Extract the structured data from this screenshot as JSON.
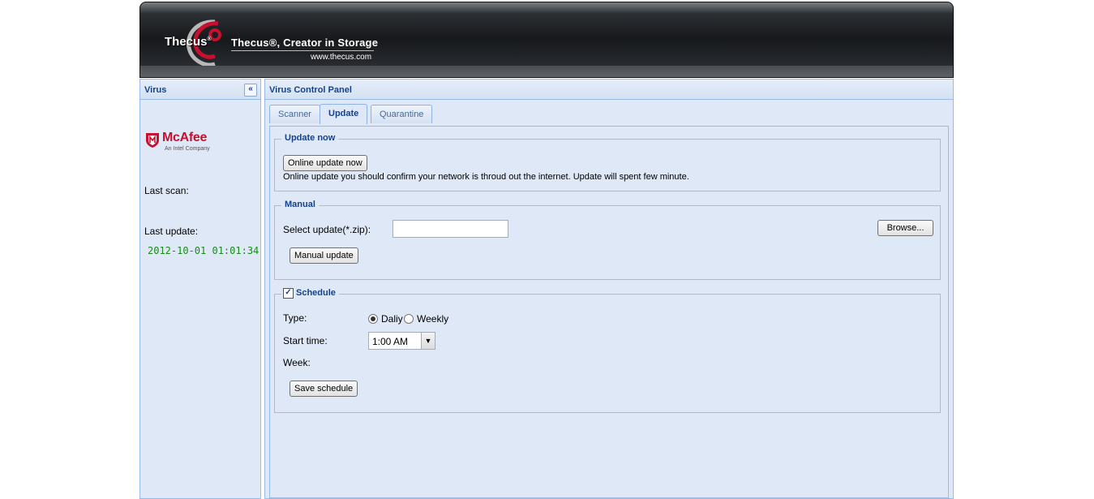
{
  "header": {
    "logo_text": "Thecus",
    "logo_mark": "®",
    "tagline": "Thecus®, Creator in Storage",
    "url": "www.thecus.com"
  },
  "left_panel": {
    "title": "Virus",
    "collapse_glyph": "«",
    "vendor_name": "McAfee",
    "vendor_sub": "An Intel Company",
    "last_scan_label": "Last scan:",
    "last_update_label": "Last update:",
    "last_update_value": "2012-10-01 01:01:34"
  },
  "main": {
    "title": "Virus Control Panel",
    "tabs": [
      {
        "label": "Scanner",
        "active": false
      },
      {
        "label": "Update",
        "active": true
      },
      {
        "label": "Quarantine",
        "active": false
      }
    ],
    "update_now": {
      "legend": "Update now",
      "button": "Online update now",
      "note": "Online update you should confirm your network is throud out the internet. Update will spent few minute."
    },
    "manual": {
      "legend": "Manual",
      "select_label": "Select update(*.zip):",
      "file_value": "",
      "browse_button": "Browse...",
      "update_button": "Manual update"
    },
    "schedule": {
      "legend": "Schedule",
      "enabled": true,
      "check_glyph": "✓",
      "type_label": "Type:",
      "type_options": [
        "Daliy",
        "Weekly"
      ],
      "type_selected": "Daliy",
      "start_time_label": "Start time:",
      "start_time_value": "1:00 AM",
      "week_label": "Week:",
      "save_button": "Save schedule"
    }
  },
  "colors": {
    "panel_bg": "#dfe8f6",
    "header_text": "#15428b",
    "date_green": "#1a8a1a",
    "mcafee_red": "#c8102e"
  }
}
